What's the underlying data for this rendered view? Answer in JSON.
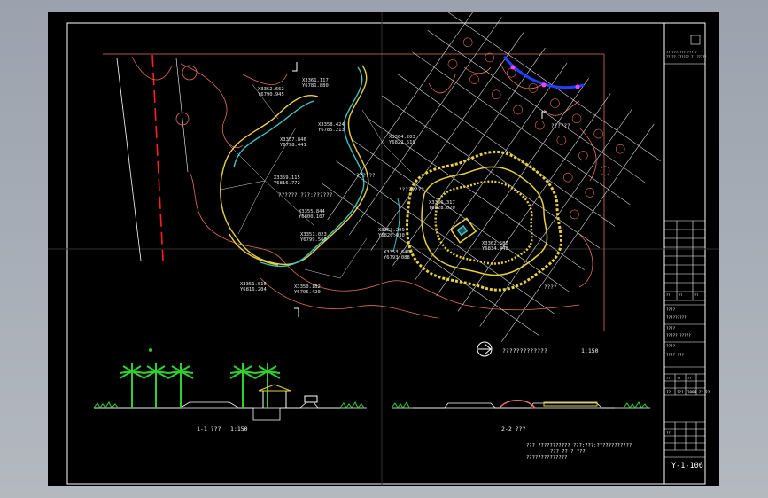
{
  "drawing": {
    "drawing_number": "Y-1-106",
    "plan_caption": "?????????????",
    "plan_scale": "1:150",
    "section1_caption": "1-1 ???",
    "section1_scale": "1:150",
    "section2_caption": "2-2 ???",
    "notes": [
      "??? ??????????? ???:???:????????????",
      "??? ?? ? ???",
      "??????????????"
    ],
    "coordinate_labels": [
      {
        "a": "X3361.117",
        "b": "Y6781.880"
      },
      {
        "a": "X3362.662",
        "b": "Y6790.945"
      },
      {
        "a": "X3358.424",
        "b": "Y6785.213"
      },
      {
        "a": "X3357.846",
        "b": "Y6798.441"
      },
      {
        "a": "X3359.115",
        "b": "Y6816.772"
      },
      {
        "a": "X3355.844",
        "b": "Y6800.107"
      },
      {
        "a": "X3351.023",
        "b": "Y6799.560"
      },
      {
        "a": "X3351.010",
        "b": "Y6816.204"
      },
      {
        "a": "X3350.182",
        "b": "Y6795.420"
      },
      {
        "a": "X3353.640",
        "b": "Y6793.088"
      },
      {
        "a": "X3364.203",
        "b": "Y6822.518"
      },
      {
        "a": "X3356.317",
        "b": "Y6828.020"
      },
      {
        "a": "X3362.580",
        "b": "Y6834.448"
      },
      {
        "a": "X3353.209",
        "b": "Y6820.930"
      }
    ],
    "plan_labels": [
      "??????",
      "?????? ???:??????",
      "????????",
      "??????",
      "????"
    ]
  },
  "title_block": {
    "company_line1": "?????????? ?????",
    "company_line2": "????? ?????? ?? ?????",
    "project_label": "????",
    "project_value": "?????????",
    "drawing_label": "????",
    "drawing_value": "?????  ?????",
    "content_label": "????",
    "content_value": "????  ???",
    "grade_label": "??",
    "grade_value": "???",
    "date_label": "??",
    "date_value": "2009.??.??",
    "table_cells": [
      "??",
      "??",
      "??",
      "??",
      "??",
      "??"
    ]
  },
  "colors": {
    "background": "#000000",
    "frame": "#ffffff",
    "contour": "#e07060",
    "path_yellow": "#e8d040",
    "path_cyan": "#40c0c0",
    "grid": "#d8d8d8",
    "red_line": "#ff2020",
    "tree_green": "#30d030",
    "blue_accent": "#2040ff"
  }
}
